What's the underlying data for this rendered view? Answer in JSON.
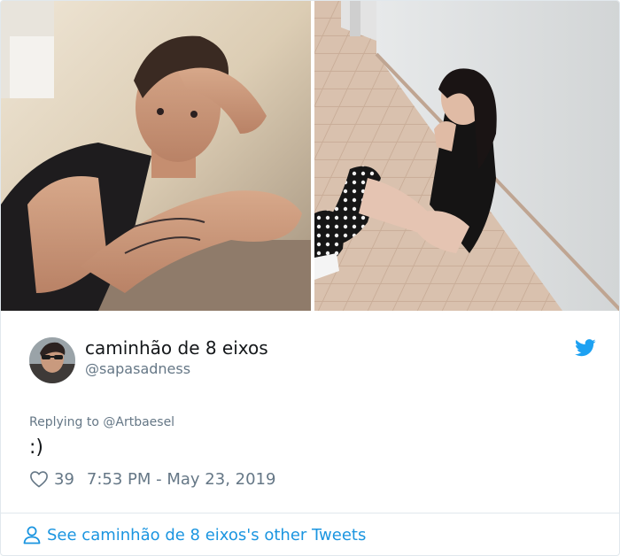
{
  "tweet": {
    "display_name": "caminhão de 8 eixos",
    "screen_name": "@sapasadness",
    "replying_to": "Replying to @Artbaesel",
    "text": ":)",
    "likes": "39",
    "timestamp": "7:53 PM - May 23, 2019"
  },
  "footer": {
    "link_text": "See caminhão de 8 eixos's other Tweets"
  },
  "icons": {
    "brand": "twitter-bird-icon",
    "like": "heart-outline-icon",
    "profile": "person-outline-icon"
  },
  "colors": {
    "accent": "#1da1f2",
    "link": "#1b95e0",
    "secondary_text": "#657786",
    "primary_text": "#14171a",
    "border": "#e1e8ed"
  }
}
